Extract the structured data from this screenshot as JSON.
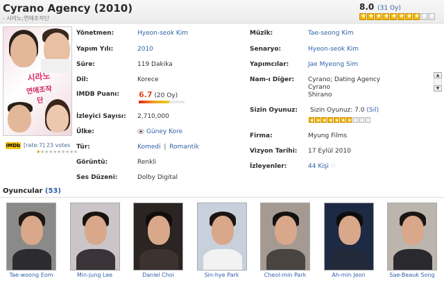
{
  "header": {
    "title": "Cyrano Agency (2010)",
    "subtitle": "- 시라노;연애조작단",
    "score": "8.0",
    "votes": "(31 Oy)",
    "star_count": 10,
    "star_filled": 8
  },
  "imdb_box": {
    "logo": "IMDb",
    "rate_text": "[rate:7] 23 votes",
    "star_filled": 1,
    "star_count": 10
  },
  "left_rows": [
    {
      "label": "Yönetmen:",
      "value": "Hyeon-seok Kim",
      "link": true
    },
    {
      "label": "Yapım Yılı:",
      "value": "2010",
      "link": true
    },
    {
      "label": "Süre:",
      "value": "119 Dakika",
      "link": false
    },
    {
      "label": "Dil:",
      "value": "Korece",
      "link": false
    },
    {
      "label": "IMDB Puanı:",
      "value": "6.7",
      "extra": "(20 Oy)",
      "link": false
    },
    {
      "label": "İzleyici Sayısı:",
      "value": "2,710,000",
      "link": false
    },
    {
      "label": "Ülke:",
      "value": "Güney Kore",
      "link": true
    },
    {
      "label": "Tür:",
      "value": "Komedi",
      "value2": "Romantik",
      "sep": "|",
      "link": true
    },
    {
      "label": "Görüntü:",
      "value": "Renkli",
      "link": false
    },
    {
      "label": "Ses Düzeni:",
      "value": "Dolby Digital",
      "link": false
    }
  ],
  "imdb_fraction": 0.67,
  "right_rows": [
    {
      "label": "Müzik:",
      "value": "Tae-seong Kim",
      "link": true
    },
    {
      "label": "Senaryo:",
      "value": "Hyeon-seok Kim",
      "link": true
    },
    {
      "label": "Yapımcılar:",
      "value": "Jae Myeong Sim",
      "link": true
    },
    {
      "label": "Nam-ı Diğer:",
      "values": [
        "Cyrano; Dating Agency",
        "Cyrano",
        "Shirano"
      ],
      "link": false
    },
    {
      "label": "Sizin Oyunuz:",
      "value": "Sizin Oyunuz: 7.0",
      "action": "(Sil)",
      "star_filled": 7,
      "star_count": 10
    },
    {
      "label": "Firma:",
      "value": "Myung Films",
      "link": false
    },
    {
      "label": "Vizyon Tarihi:",
      "value": "17 Eylül 2010",
      "link": false
    },
    {
      "label": "İzleyenler:",
      "value": "44 Kişi",
      "link": true
    }
  ],
  "cast": {
    "title": "Oyuncular",
    "count": "(53)",
    "members": [
      {
        "name": "Tae-woong Eom",
        "bg": "#8a8a88",
        "hair": "#1c1712",
        "body": "#2b2b30"
      },
      {
        "name": "Min-jung Lee",
        "bg": "#c9c5c8",
        "hair": "#1a120e",
        "body": "#3a3438"
      },
      {
        "name": "Daniel Choi",
        "bg": "#2a2422",
        "hair": "#120e0c",
        "body": "#3c3230"
      },
      {
        "name": "Sin-hye Park",
        "bg": "#c8d0dc",
        "hair": "#1a1512",
        "body": "#f2f2f2"
      },
      {
        "name": "Cheol-min Park",
        "bg": "#a59a92",
        "hair": "#141210",
        "body": "#4a4440"
      },
      {
        "name": "Ah-min Jeon",
        "bg": "#1e2a44",
        "hair": "#0e0c0c",
        "body": "#222a3a"
      },
      {
        "name": "Sae-Beauk Song",
        "bg": "#bbb5ae",
        "hair": "#1a1614",
        "body": "#2a2a2e"
      }
    ]
  }
}
